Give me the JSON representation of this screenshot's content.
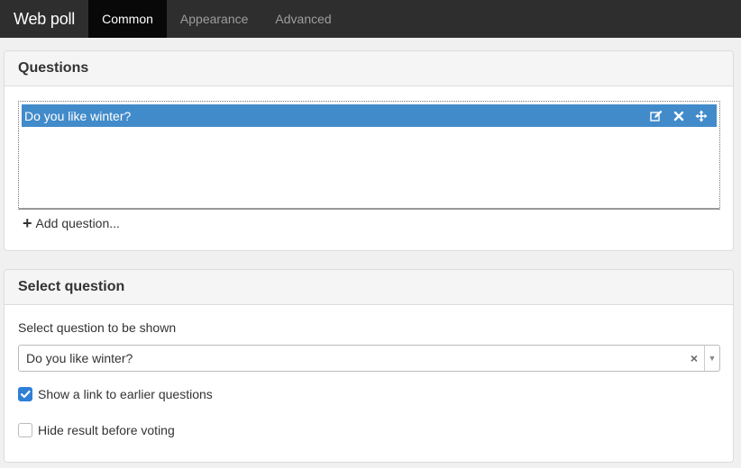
{
  "navbar": {
    "brand": "Web poll",
    "tabs": [
      {
        "label": "Common",
        "active": true
      },
      {
        "label": "Appearance",
        "active": false
      },
      {
        "label": "Advanced",
        "active": false
      }
    ]
  },
  "questions_panel": {
    "title": "Questions",
    "items": [
      {
        "text": "Do you like winter?",
        "actions": [
          "edit-icon",
          "delete-icon",
          "move-icon"
        ]
      }
    ],
    "add_label": "Add question..."
  },
  "select_panel": {
    "title": "Select question",
    "field_label": "Select question to be shown",
    "selected_value": "Do you like winter?",
    "clear_glyph": "×",
    "arrow_glyph": "▼",
    "checkboxes": [
      {
        "label": "Show a link to earlier questions",
        "checked": true
      },
      {
        "label": "Hide result before voting",
        "checked": false
      }
    ]
  },
  "colors": {
    "accent": "#428bca",
    "navbar_bg": "#2e2e2e",
    "active_tab_bg": "#080808",
    "checkbox_checked": "#2f7fd6"
  }
}
